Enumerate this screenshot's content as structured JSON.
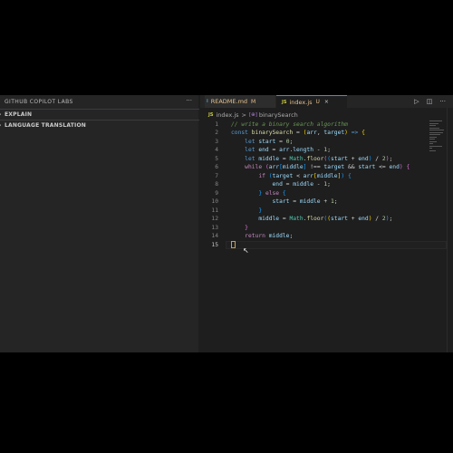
{
  "sidebar": {
    "title": "GITHUB COPILOT LABS",
    "more_icon": "ellipsis-icon",
    "sections": [
      {
        "label": "EXPLAIN"
      },
      {
        "label": "LANGUAGE TRANSLATION"
      }
    ]
  },
  "tabs": [
    {
      "icon_text": "i",
      "label": "README.md",
      "modified": "M"
    },
    {
      "icon_text": "JS",
      "label": "index.js",
      "modified": "U",
      "close": "×"
    }
  ],
  "tab_actions": [
    "run-icon",
    "split-editor-icon",
    "ellipsis-icon"
  ],
  "breadcrumb": {
    "file_icon": "JS",
    "file": "index.js",
    "separator": ">",
    "symbol_icon": "[⊕]",
    "symbol": "binarySearch"
  },
  "code": {
    "line_numbers": [
      "1",
      "2",
      "3",
      "4",
      "5",
      "6",
      "7",
      "8",
      "9",
      "10",
      "11",
      "12",
      "13",
      "14",
      "15"
    ],
    "active_line": "15"
  },
  "colors": {
    "accent": "#3b8eea",
    "keyword": "#569cd6",
    "function": "#dcdcaa",
    "variable": "#9cdcfe",
    "comment": "#6a9955"
  }
}
